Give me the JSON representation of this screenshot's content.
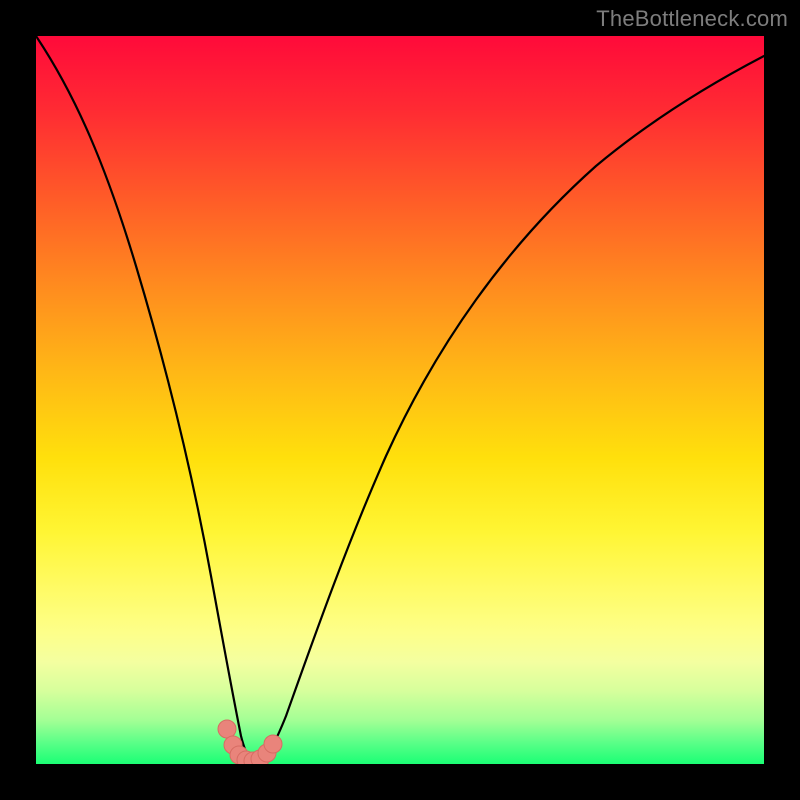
{
  "watermark": "TheBottleneck.com",
  "chart_data": {
    "type": "line",
    "title": "",
    "xlabel": "",
    "ylabel": "",
    "xlim": [
      0,
      100
    ],
    "ylim": [
      0,
      100
    ],
    "background_gradient": {
      "top": "#ff0a3a",
      "mid": "#ffe00c",
      "bottom": "#1bff75"
    },
    "series": [
      {
        "name": "bottleneck-curve",
        "x": [
          0,
          5,
          10,
          15,
          18,
          21,
          24,
          26,
          27.5,
          29,
          30.5,
          32,
          34,
          36,
          38,
          42,
          48,
          55,
          62,
          70,
          78,
          86,
          94,
          100
        ],
        "values": [
          100,
          84,
          66,
          48,
          36,
          24,
          12,
          4,
          1,
          0,
          0.5,
          2,
          6,
          12,
          20,
          34,
          50,
          63,
          72,
          80,
          86,
          91,
          95,
          98
        ]
      }
    ],
    "markers": {
      "name": "minimum-salmon-markers",
      "color": "#e9847b",
      "points_xy": [
        [
          26.2,
          5.0
        ],
        [
          27.1,
          2.6
        ],
        [
          27.8,
          1.2
        ],
        [
          28.6,
          0.5
        ],
        [
          29.6,
          0.4
        ],
        [
          30.6,
          0.6
        ],
        [
          31.6,
          1.4
        ],
        [
          32.4,
          2.8
        ]
      ]
    }
  }
}
